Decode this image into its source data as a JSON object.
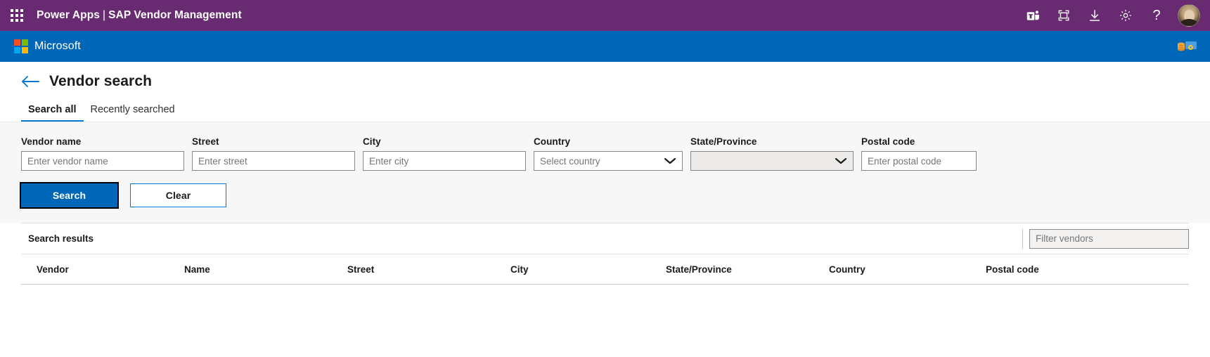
{
  "suite": {
    "waffle_icon": "app-launcher-waffle-icon",
    "app_name": "Power Apps",
    "separator": "|",
    "env_name": "SAP Vendor Management",
    "actions": [
      {
        "name": "teams-icon",
        "label": "Teams"
      },
      {
        "name": "fullscreen-icon",
        "label": "Fullscreen"
      },
      {
        "name": "download-icon",
        "label": "Download"
      },
      {
        "name": "gear-icon",
        "label": "Settings"
      },
      {
        "name": "help-icon",
        "label": "Help",
        "glyph": "?"
      }
    ],
    "avatar_name": "user-avatar"
  },
  "ms_bar": {
    "brand": "Microsoft",
    "logo_icon": "microsoft-logo-icon",
    "right_icon": "data-settings-icon",
    "colors": {
      "bar": "#0067B8",
      "red": "#F25022",
      "green": "#7FBA00",
      "blue": "#00A4EF",
      "yellow": "#FFB900"
    }
  },
  "page": {
    "back_icon": "back-arrow-icon",
    "title": "Vendor search"
  },
  "tabs": [
    {
      "label": "Search all",
      "active": true
    },
    {
      "label": "Recently searched",
      "active": false
    }
  ],
  "search_form": {
    "fields": [
      {
        "key": "vendor_name",
        "label": "Vendor name",
        "placeholder": "Enter vendor name",
        "value": "",
        "type": "text"
      },
      {
        "key": "street",
        "label": "Street",
        "placeholder": "Enter street",
        "value": "",
        "type": "text"
      },
      {
        "key": "city",
        "label": "City",
        "placeholder": "Enter city",
        "value": "",
        "type": "text"
      },
      {
        "key": "country",
        "label": "Country",
        "placeholder": "Select country",
        "value": "Select country",
        "type": "select",
        "disabled": false
      },
      {
        "key": "state",
        "label": "State/Province",
        "placeholder": "",
        "value": "",
        "type": "select",
        "disabled": true
      },
      {
        "key": "postal_code",
        "label": "Postal code",
        "placeholder": "Enter postal code",
        "value": "",
        "type": "text"
      }
    ],
    "buttons": {
      "search": "Search",
      "clear": "Clear"
    }
  },
  "results": {
    "title": "Search results",
    "filter_placeholder": "Filter vendors",
    "filter_value": "",
    "columns": [
      "Vendor",
      "Name",
      "Street",
      "City",
      "State/Province",
      "Country",
      "Postal code"
    ],
    "rows": []
  },
  "colors": {
    "suite_purple": "#682A71",
    "ms_blue": "#0067B8",
    "accent_blue": "#0078D4",
    "form_bg": "#F7F7F7",
    "text": "#1b1a19"
  }
}
